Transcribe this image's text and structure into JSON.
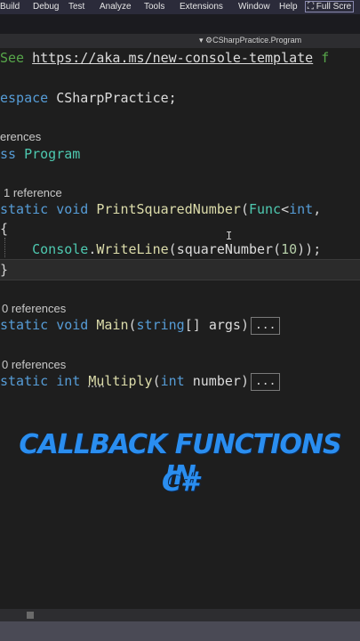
{
  "menubar": {
    "items": [
      "Build",
      "Debug",
      "Test",
      "Analyze",
      "Tools",
      "Extensions",
      "Window",
      "Help"
    ],
    "full_screen": "Full Scre"
  },
  "navbar": {
    "class_path": "CSharpPractice.Program"
  },
  "code": {
    "comment_see": "See ",
    "comment_url": "https://aka.ms/new-console-template",
    "comment_tail": " f",
    "ns_kw": "espace ",
    "ns_name": "CSharpPractice;",
    "lens_top": "erences",
    "cls_kw": "ss ",
    "cls_name": "Program",
    "lens1": "1 reference",
    "m1_static": "static ",
    "m1_void": "void ",
    "m1_name": "PrintSquaredNumber",
    "m1_paren": "(",
    "m1_type": "Func",
    "m1_lt": "<",
    "m1_int": "int",
    "m1_comma": ",",
    "brace_open": "{",
    "call_class": "Console",
    "call_dot": ".",
    "call_method": "WriteLine",
    "call_open": "(",
    "call_arg": "squareNumber",
    "call_open2": "(",
    "call_num": "10",
    "call_close": "));",
    "brace_close": "}",
    "lens2": "0 references",
    "m2_static": "static ",
    "m2_void": "void ",
    "m2_name": "Main",
    "m2_open": "(",
    "m2_type": "string",
    "m2_arr": "[] ",
    "m2_arg": "args",
    "m2_close": ")",
    "collapsed": "...",
    "lens3": "0 references",
    "m3_static": "static ",
    "m3_int": "int ",
    "m3_name_a": "Mu",
    "m3_name_b": "ltiply",
    "m3_open": "(",
    "m3_type": "int ",
    "m3_arg": "number",
    "m3_close": ")"
  },
  "overlay": {
    "line1": "CALLBACK FUNCTIONS IN",
    "line2": "C#"
  },
  "cursor_glyph": "I",
  "colors": {
    "keyword": "#569cd6",
    "method": "#dcdcaa",
    "type": "#4ec9b0",
    "number": "#b5cea8",
    "title": "#2a8ef0"
  }
}
